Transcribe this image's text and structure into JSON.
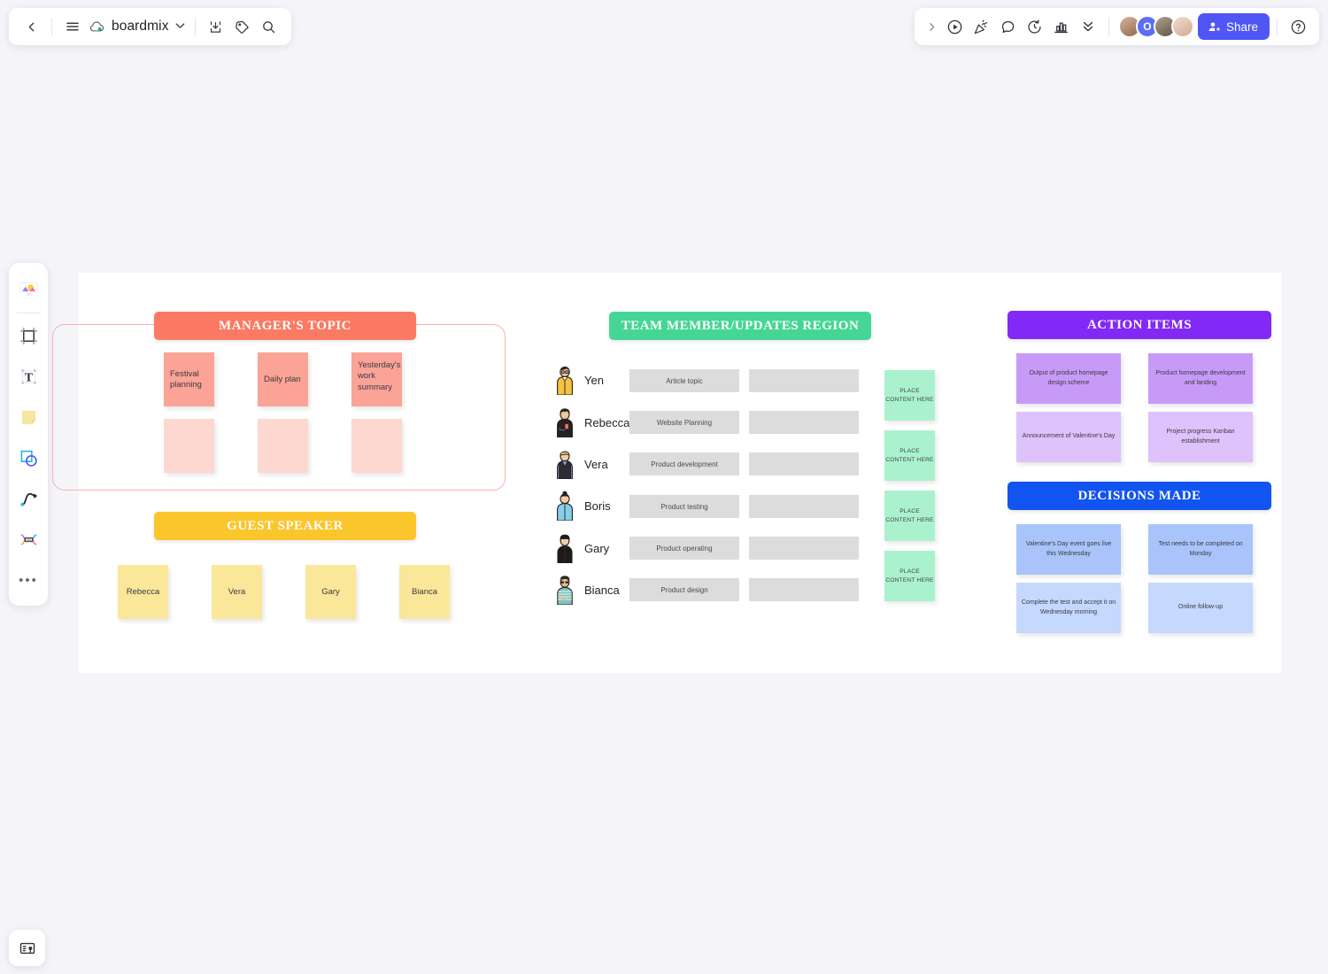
{
  "app": {
    "brand_name": "boardmix",
    "share_label": "Share"
  },
  "top_left_toolbar": {
    "items": [
      {
        "name": "back",
        "icon": "chevron-left-icon"
      },
      {
        "name": "menu",
        "icon": "hamburger-menu-icon"
      },
      {
        "name": "cloud",
        "icon": "cloud-icon"
      },
      {
        "name": "export",
        "icon": "download-icon"
      },
      {
        "name": "tag",
        "icon": "tag-icon"
      },
      {
        "name": "search",
        "icon": "search-icon"
      }
    ]
  },
  "top_right_toolbar": {
    "items": [
      {
        "name": "expand",
        "icon": "chevron-right-icon"
      },
      {
        "name": "present",
        "icon": "play-circle-icon"
      },
      {
        "name": "celebrate",
        "icon": "party-popper-icon"
      },
      {
        "name": "comment",
        "icon": "chat-bubble-icon"
      },
      {
        "name": "timer",
        "icon": "timer-icon"
      },
      {
        "name": "vote",
        "icon": "bar-chart-icon"
      },
      {
        "name": "more",
        "icon": "double-chevron-down-icon"
      },
      {
        "name": "help",
        "icon": "question-circle-icon"
      }
    ],
    "avatars": [
      {
        "name": "avatar-1",
        "initial": "",
        "color": "#c9a28c"
      },
      {
        "name": "avatar-2",
        "initial": "O",
        "color": "#5b6ef5"
      },
      {
        "name": "avatar-3",
        "initial": "",
        "color": "#8a7f6b"
      },
      {
        "name": "avatar-4",
        "initial": "",
        "color": "#e3cbbd"
      }
    ]
  },
  "left_rail": {
    "items": [
      {
        "name": "templates",
        "icon": "templates-icon"
      },
      {
        "name": "frame",
        "icon": "frame-icon"
      },
      {
        "name": "text",
        "icon": "text-icon"
      },
      {
        "name": "sticky-note",
        "icon": "sticky-note-icon"
      },
      {
        "name": "shape",
        "icon": "shape-icon"
      },
      {
        "name": "pen",
        "icon": "curve-pen-icon"
      },
      {
        "name": "mindmap",
        "icon": "mindmap-icon"
      },
      {
        "name": "more-tools",
        "icon": "ellipsis-icon"
      }
    ],
    "bottom_button": {
      "name": "presentation-mode",
      "icon": "presentation-icon"
    }
  },
  "board": {
    "managers_topic": {
      "title": "MANAGER'S TOPIC",
      "header_color": "#fb7a63",
      "notes_row1": [
        {
          "text": "Festival planning",
          "color": "#fba396"
        },
        {
          "text": "Daily plan",
          "color": "#fba396"
        },
        {
          "text": "Yesterday's work summary",
          "color": "#fba396"
        }
      ],
      "notes_row2": [
        {
          "text": "",
          "color": "#fcd8d1"
        },
        {
          "text": "",
          "color": "#fcd8d1"
        },
        {
          "text": "",
          "color": "#fcd8d1"
        }
      ]
    },
    "guest_speaker": {
      "title": "GUEST SPEAKER",
      "header_color": "#fbc52c",
      "notes": [
        {
          "text": "Rebecca",
          "color": "#fbe79a"
        },
        {
          "text": "Vera",
          "color": "#fbe79a"
        },
        {
          "text": "Gary",
          "color": "#fbe79a"
        },
        {
          "text": "Bianca",
          "color": "#fbe79a"
        }
      ]
    },
    "team_region": {
      "title": "TEAM MEMBER/UPDATES REGION",
      "header_color": "#45d695",
      "members": [
        {
          "name": "Yen",
          "topic": "Article topic",
          "second": ""
        },
        {
          "name": "Rebecca",
          "topic": "Website Planning",
          "second": ""
        },
        {
          "name": "Vera",
          "topic": "Product development",
          "second": ""
        },
        {
          "name": "Boris",
          "topic": "Product testing",
          "second": ""
        },
        {
          "name": "Gary",
          "topic": "Product operating",
          "second": ""
        },
        {
          "name": "Bianca",
          "topic": "Product design",
          "second": ""
        }
      ],
      "placeholder_notes": [
        "PLACE CONTENT HERE",
        "PLACE CONTENT HERE",
        "PLACE CONTENT HERE",
        "PLACE CONTENT HERE"
      ]
    },
    "action_items": {
      "title": "ACTION ITEMS",
      "header_color": "#8329f5",
      "notes": [
        {
          "text": "Output of product homepage design scheme",
          "color": "#c79af8"
        },
        {
          "text": "Product homepage development and landing",
          "color": "#c79af8"
        },
        {
          "text": "Announcement of Valentine's Day",
          "color": "#ddc2fb"
        },
        {
          "text": "Project progress Kanban establishment",
          "color": "#ddc2fb"
        }
      ]
    },
    "decisions_made": {
      "title": "DECISIONS MADE",
      "header_color": "#1254f0",
      "notes": [
        {
          "text": "Valentine's Day event goes live this Wednesday",
          "color": "#a8c4fa"
        },
        {
          "text": "Test needs to be completed on Monday",
          "color": "#a8c4fa"
        },
        {
          "text": "Complete the test and accept it on Wednesday morning",
          "color": "#c5d8fd"
        },
        {
          "text": "Online follow-up",
          "color": "#c5d8fd"
        }
      ]
    }
  }
}
